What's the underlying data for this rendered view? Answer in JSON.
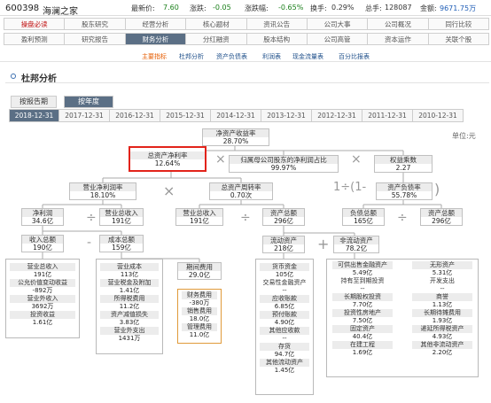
{
  "quote": {
    "code": "600398",
    "name": "海澜之家",
    "latest_label": "最新价:",
    "latest_value": "7.60",
    "change_label": "涨跌:",
    "change_value": "-0.05",
    "change_pct_label": "涨跌幅:",
    "change_pct_value": "-0.65%",
    "turnover_label": "换手:",
    "turnover_value": "0.29%",
    "volume_label": "总手:",
    "volume_value": "128087",
    "amount_label": "金额:",
    "amount_value": "9671.75万"
  },
  "nav_row1": [
    "操盘必读",
    "股东研究",
    "经营分析",
    "核心题材",
    "资讯公告",
    "公司大事",
    "公司概况",
    "同行比较"
  ],
  "nav_row2": [
    "盈利预测",
    "研究报告",
    "财务分析",
    "分红融资",
    "股本结构",
    "公司高管",
    "资本运作",
    "关联个股"
  ],
  "subnav": [
    "主要指标",
    "杜邦分析",
    "资产负债表",
    "利润表",
    "现金流量表",
    "百分比报表"
  ],
  "section_title": "杜邦分析",
  "tabs": [
    "按报告期",
    "按年度"
  ],
  "years": [
    "2018-12-31",
    "2017-12-31",
    "2016-12-31",
    "2015-12-31",
    "2014-12-31",
    "2013-12-31",
    "2012-12-31",
    "2011-12-31",
    "2010-12-31"
  ],
  "unit": "单位:元",
  "ops": {
    "times": "×",
    "times2": "×",
    "minus": "-",
    "divide": "÷",
    "plus": "+",
    "one_over": "1÷(1-"
  },
  "tree": {
    "roe": {
      "label": "净资产收益率",
      "value": "28.70%"
    },
    "roa": {
      "label": "总资产净利率",
      "value": "12.64%"
    },
    "parent_ratio": {
      "label": "归属母公司股东的净利润占比",
      "value": "99.97%"
    },
    "equity_multiplier": {
      "label": "权益乘数",
      "value": "2.27"
    },
    "net_margin": {
      "label": "营业净利润率",
      "value": "18.10%"
    },
    "asset_turnover": {
      "label": "总资产周转率",
      "value": "0.70次"
    },
    "debt_ratio": {
      "label": "资产负债率",
      "value": "55.78%"
    },
    "net_profit": {
      "label": "净利润",
      "value": "34.6亿"
    },
    "revenue1": {
      "label": "营业总收入",
      "value": "191亿"
    },
    "revenue2": {
      "label": "营业总收入",
      "value": "191亿"
    },
    "total_assets1": {
      "label": "资产总额",
      "value": "296亿"
    },
    "total_liab": {
      "label": "负债总额",
      "value": "165亿"
    },
    "total_assets2": {
      "label": "资产总额",
      "value": "296亿"
    },
    "total_income": {
      "label": "收入总额",
      "value": "190亿"
    },
    "total_cost": {
      "label": "成本总额",
      "value": "159亿"
    },
    "current_assets": {
      "label": "流动资产",
      "value": "218亿"
    },
    "noncurrent_assets": {
      "label": "非流动资产",
      "value": "78.2亿"
    },
    "income_group": [
      {
        "label": "营业总收入",
        "value": "191亿"
      },
      {
        "label": "公允价值变动收益",
        "value": "-892万"
      },
      {
        "label": "营业外收入",
        "value": "3692万"
      },
      {
        "label": "投资收益",
        "value": "1.61亿"
      }
    ],
    "cost_group": [
      {
        "label": "营业成本",
        "value": "113亿"
      },
      {
        "label": "营业税金及附加",
        "value": "1.41亿"
      },
      {
        "label": "所得税费用",
        "value": "11.2亿"
      },
      {
        "label": "资产减值损失",
        "value": "3.83亿"
      },
      {
        "label": "营业外支出",
        "value": "1431万"
      }
    ],
    "rd_expense": {
      "label": "期间费用",
      "value": "29.0亿"
    },
    "expense_group": [
      {
        "label": "财务费用",
        "value": "-380万"
      },
      {
        "label": "销售费用",
        "value": "18.0亿"
      },
      {
        "label": "管理费用",
        "value": "11.0亿"
      }
    ],
    "current_group": [
      {
        "label": "货币资金",
        "value": "105亿"
      },
      {
        "label": "交易性金融资产",
        "value": "--"
      },
      {
        "label": "应收账款",
        "value": "6.85亿"
      },
      {
        "label": "预付账款",
        "value": "4.90亿"
      },
      {
        "label": "其他应收款",
        "value": "--"
      },
      {
        "label": "存货",
        "value": "94.7亿"
      },
      {
        "label": "其他流动资产",
        "value": "1.45亿"
      }
    ],
    "noncurrent_group": [
      {
        "label": "可供出售金融资产",
        "value": "5.49亿"
      },
      {
        "label": "持有至到期投资",
        "value": "--"
      },
      {
        "label": "长期股权投资",
        "value": "7.70亿"
      },
      {
        "label": "投资性房地产",
        "value": "7.50亿"
      },
      {
        "label": "固定资产",
        "value": "40.4亿"
      },
      {
        "label": "在建工程",
        "value": "1.69亿"
      }
    ],
    "noncurrent_group2": [
      {
        "label": "无形资产",
        "value": "5.31亿"
      },
      {
        "label": "开发支出",
        "value": "--"
      },
      {
        "label": "商誉",
        "value": "1.13亿"
      },
      {
        "label": "长期待摊费用",
        "value": "1.93亿"
      },
      {
        "label": "递延所得税资产",
        "value": "4.93亿"
      },
      {
        "label": "其他非流动资产",
        "value": "2.20亿"
      }
    ]
  },
  "colors": {
    "active_tab": "#5b6f85",
    "highlight_border": "#e2231a",
    "nav_highlight": "#c01010",
    "green_value": "#1a7f1a",
    "blue_value": "#1f5db6"
  }
}
